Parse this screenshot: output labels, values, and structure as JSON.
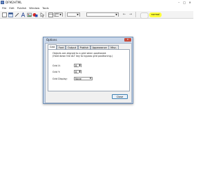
{
  "app": {
    "title": "DFM2HTML",
    "menu": [
      "File",
      "Edit",
      "Publish",
      "Window",
      "Tools"
    ],
    "toolbar": {
      "pill_blank": "",
      "pill_normal": "normal",
      "nav_back": "←",
      "nav_forward": "→"
    },
    "window_buttons": {
      "minimize": "–",
      "maximize": "□",
      "close": "✕"
    }
  },
  "dialog": {
    "title": "Options",
    "close_glyph": "✕",
    "tabs": [
      "Grid",
      "Font",
      "Output",
      "Publish",
      "Appearance",
      "Misc."
    ],
    "active_tab": "Grid",
    "description_line1": "Objects are aligned to a grid when positioned.",
    "description_line2": "(Hold down the ALT key to bypass grid positioning.)",
    "grid_x_label": "Grid X:",
    "grid_x_value": "8",
    "grid_y_label": "Grid Y:",
    "grid_y_value": "8",
    "grid_display_label": "Grid Display:",
    "grid_display_value": "None",
    "close_button": "Close"
  },
  "colors": {
    "accent_pill": "#ffff3a",
    "dialog_frame": "#c9d7ea",
    "close_x": "#c74b3b"
  }
}
